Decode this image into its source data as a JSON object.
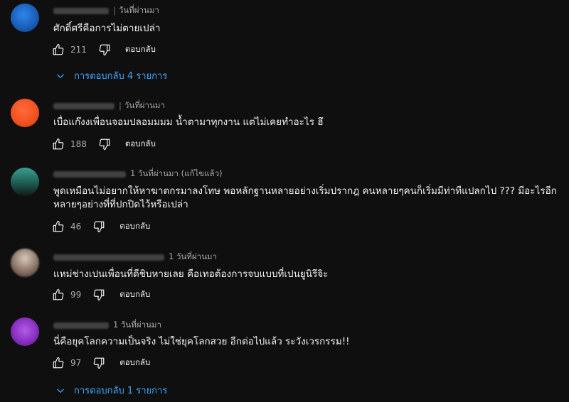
{
  "comments": [
    {
      "time": "วันที่ผ่านมา",
      "text_lines": [
        "ศักดิ์ศรีคือการไม่ตายเปล่า"
      ],
      "likes": "211",
      "reply_label": "ตอบกลับ",
      "replies_label": "การตอบกลับ 4 รายการ",
      "avatar_color": "#1b6fd1"
    },
    {
      "time": "วันที่ผ่านมา",
      "text_lines": [
        "เบื่อแก๊งงเพื่อนจอมปลอมมมม น้ำตามาทุกงาน แต่ไม่เคยทำอะไร ฮึ"
      ],
      "likes": "188",
      "reply_label": "ตอบกลับ",
      "avatar_color": "#f1501f"
    },
    {
      "time": "1 วันที่ผ่านมา (แก้ไขแล้ว)",
      "text_lines": [
        "พูดเหมือนไม่อยากให้หาฆาตกรมาลงโทษ  พอหลักฐานหลายอย่างเริ่มปรากฎ คนหลายๆคนก็เริ่มมีท่าทีแปลกไป ???  มีอะไรอีก",
        "หลายๆอย่างที่ที่ปกปิดไว้หรือเปล่า"
      ],
      "likes": "46",
      "reply_label": "ตอบกลับ",
      "avatar_color": "#2a6f66"
    },
    {
      "time": "1 วันที่ผ่านมา",
      "text_lines": [
        "แหม่ช่างเปนเพื่อนที่ดีชิบหายเลย คือเทอต้องการจบแบบที่เปนยูนิรีจิะ"
      ],
      "likes": "99",
      "reply_label": "ตอบกลับ",
      "avatar_color": "#8a7468"
    },
    {
      "time": "1 วันที่ผ่านมา",
      "text_lines": [
        "นี่คือยุคโลกความเป็นจริง ไม่ใช่ยุคโลกสวย อีกต่อไปแล้ว ระวังเวรกรรม!!"
      ],
      "likes": "97",
      "reply_label": "ตอบกลับ",
      "replies_label": "การตอบกลับ 1 รายการ",
      "avatar_color": "#8a2fc2"
    }
  ],
  "colors": {
    "background": "#0f0f0f",
    "text": "#f1f1f1",
    "muted": "#aaaaaa",
    "link": "#3ea6ff"
  },
  "icons": {
    "like": "thumbs-up-icon",
    "dislike": "thumbs-down-icon",
    "expand": "chevron-down-icon"
  }
}
